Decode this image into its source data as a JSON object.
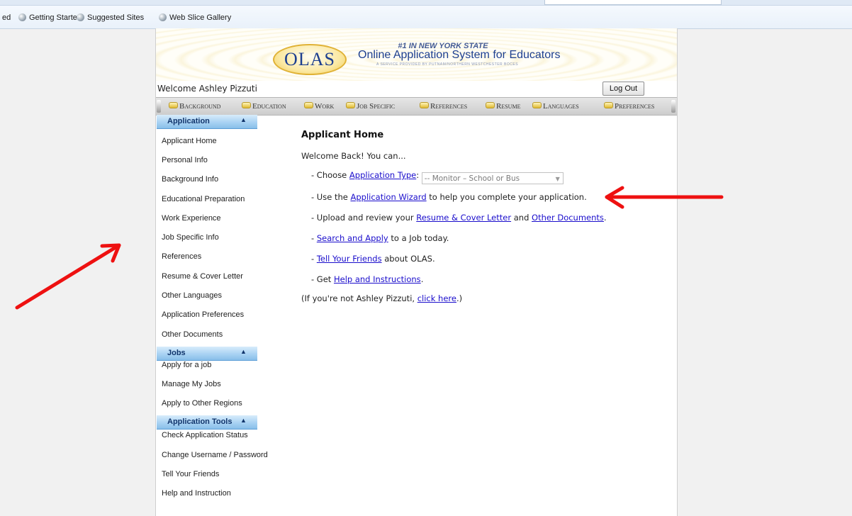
{
  "favorites": [
    {
      "label": "ed"
    },
    {
      "label": "Getting Started"
    },
    {
      "label": "Suggested Sites"
    },
    {
      "label": "Web Slice Gallery"
    }
  ],
  "banner": {
    "logo_text": "OLAS",
    "tagline_top": "#1 IN NEW YORK STATE",
    "tagline_main": "Online Application System for Educators",
    "tagline_sub": "A SERVICE PROVIDED BY PUTNAM/NORTHERN WESTCHESTER BOCES"
  },
  "header": {
    "welcome": "Welcome Ashley Pizzuti",
    "logout_label": "Log Out"
  },
  "tabs": [
    "Background",
    "Education",
    "Work",
    "Job Specific",
    "References",
    "Resume",
    "Languages",
    "Preferences"
  ],
  "sidebar": {
    "application": {
      "title": "Application",
      "items": [
        "Applicant Home",
        "Personal Info",
        "Background Info",
        "Educational Preparation",
        "Work Experience",
        "Job Specific Info",
        "References",
        "Resume & Cover Letter",
        "Other Languages",
        "Application Preferences",
        "Other Documents"
      ]
    },
    "jobs": {
      "title": "Jobs",
      "items": [
        "Apply for a job",
        "Manage My Jobs",
        "Apply to Other Regions"
      ]
    },
    "tools": {
      "title": "Application Tools",
      "items": [
        "Check Application Status",
        "Change Username / Password",
        "Tell Your Friends",
        "Help and Instruction"
      ]
    }
  },
  "main": {
    "title": "Applicant Home",
    "intro": "Welcome Back! You can...",
    "line1": {
      "pre": "- Choose ",
      "link": "Application Type",
      "post": ":",
      "select_value": "-- Monitor – School or Bus"
    },
    "line2": {
      "pre": "- Use the ",
      "link": "Application Wizard",
      "post": " to help you complete your application."
    },
    "line3": {
      "pre": "- Upload and review your ",
      "link1": "Resume & Cover Letter",
      "mid": " and ",
      "link2": "Other Documents",
      "post": "."
    },
    "line4": {
      "pre": "- ",
      "link": "Search and Apply",
      "post": " to a Job today."
    },
    "line5": {
      "pre": "- ",
      "link": "Tell Your Friends",
      "post": " about OLAS."
    },
    "line6": {
      "pre": "- Get ",
      "link": "Help and Instructions",
      "post": "."
    },
    "line7": {
      "pre": "(If you're not Ashley Pizzuti, ",
      "link": "click here",
      "post": ".)"
    }
  },
  "colors": {
    "annotation_arrow": "#ee1111",
    "link": "#1a0dcc"
  }
}
